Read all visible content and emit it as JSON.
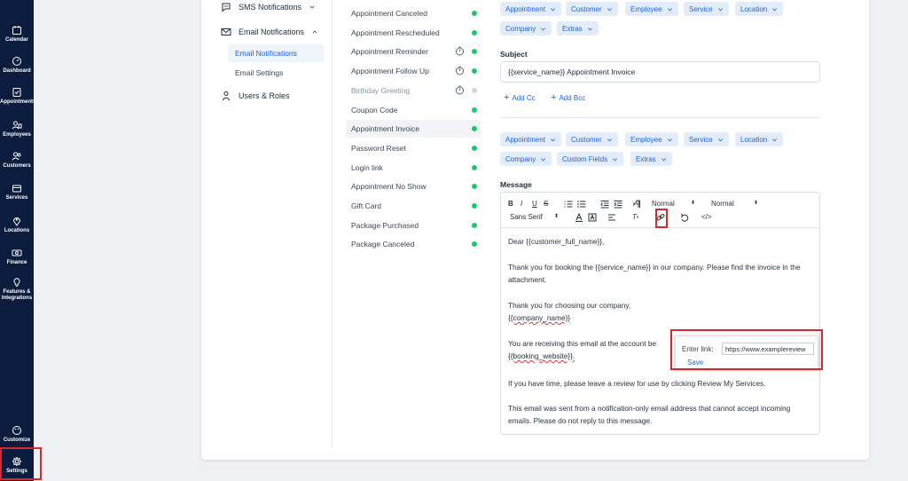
{
  "leftnav": {
    "items": [
      {
        "label": "Calendar",
        "icon": "calendar-icon"
      },
      {
        "label": "Dashboard",
        "icon": "dashboard-icon"
      },
      {
        "label": "Appointments",
        "icon": "appointments-icon"
      },
      {
        "label": "Employees",
        "icon": "employees-icon"
      },
      {
        "label": "Customers",
        "icon": "customers-icon"
      },
      {
        "label": "Services",
        "icon": "services-icon"
      },
      {
        "label": "Locations",
        "icon": "locations-icon"
      },
      {
        "label": "Finance",
        "icon": "finance-icon"
      },
      {
        "label": "Features &",
        "label2": "Integrations",
        "icon": "features-icon"
      },
      {
        "label": "Customize",
        "icon": "customize-icon"
      },
      {
        "label": "Settings",
        "icon": "settings-icon"
      }
    ]
  },
  "sidemenu": {
    "sms": "SMS Notifications",
    "email": "Email Notifications",
    "email_sub": [
      "Email Notifications",
      "Email Settings"
    ],
    "users": "Users & Roles"
  },
  "notifications": [
    {
      "label": "Appointment Canceled",
      "timer": false,
      "enabled": true
    },
    {
      "label": "Appointment Rescheduled",
      "timer": false,
      "enabled": true
    },
    {
      "label": "Appointment Reminder",
      "timer": true,
      "enabled": true
    },
    {
      "label": "Appointment Follow Up",
      "timer": true,
      "enabled": true
    },
    {
      "label": "Birthday Greeting",
      "timer": true,
      "enabled": false
    },
    {
      "label": "Coupon Code",
      "timer": false,
      "enabled": true
    },
    {
      "label": "Appointment Invoice",
      "timer": false,
      "enabled": true,
      "selected": true
    },
    {
      "label": "Password Reset",
      "timer": false,
      "enabled": true
    },
    {
      "label": "Login link",
      "timer": false,
      "enabled": true
    },
    {
      "label": "Appointment No Show",
      "timer": false,
      "enabled": true
    },
    {
      "label": "Gift Card",
      "timer": false,
      "enabled": true
    },
    {
      "label": "Package Purchased",
      "timer": false,
      "enabled": true
    },
    {
      "label": "Package Canceled",
      "timer": false,
      "enabled": true
    }
  ],
  "editor": {
    "chips_top": [
      "Appointment",
      "Customer",
      "Employee",
      "Service",
      "Location",
      "Company",
      "Extras"
    ],
    "subject_label": "Subject",
    "subject_value": "{{service_name}} Appointment Invoice",
    "add_cc": "Add Cc",
    "add_bcc": "Add Bcc",
    "chips_msg": [
      "Appointment",
      "Customer",
      "Employee",
      "Service",
      "Location",
      "Company",
      "Custom Fields",
      "Extras"
    ],
    "message_label": "Message",
    "toolbar": {
      "bold": "B",
      "italic": "I",
      "underline": "U",
      "strike": "S",
      "size1": "Normal",
      "size2": "Normal",
      "font": "Sans Serif",
      "clean": "T",
      "code": "</>"
    },
    "body": {
      "p1": "Dear {{customer_full_name}},",
      "p2": "Thank you for booking the {{service_name}} in our company. Please find the invoice in the attachment.",
      "p3a": "Thank you for choosing our company,",
      "p3b": "{{company_name}}",
      "p4a": "You are receiving this email at the account be",
      "p4b": "{{booking_website}}.",
      "p5": "If you have time, please leave a review for use by clicking Review My Services.",
      "p6": "This email was sent from a notification-only email address that cannot accept incoming emails. Please do not reply to this message."
    }
  },
  "link_popup": {
    "label": "Enter link:",
    "value": "https://www.examplereview",
    "save": "Save"
  }
}
